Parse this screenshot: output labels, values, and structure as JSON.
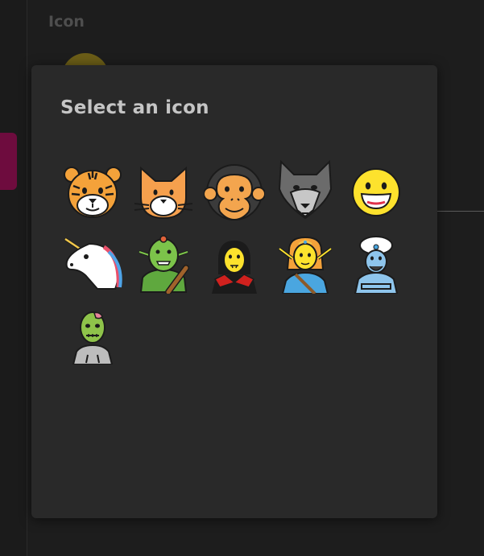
{
  "background": {
    "field_label": "Icon"
  },
  "modal": {
    "title": "Select an icon"
  },
  "icons": [
    {
      "name": "tiger-face"
    },
    {
      "name": "cat-face"
    },
    {
      "name": "monkey-face"
    },
    {
      "name": "wolf-face"
    },
    {
      "name": "grinning-face"
    },
    {
      "name": "unicorn-face"
    },
    {
      "name": "troll"
    },
    {
      "name": "vampire"
    },
    {
      "name": "elf"
    },
    {
      "name": "genie"
    },
    {
      "name": "zombie"
    }
  ],
  "colors": {
    "modal_bg": "#292929",
    "page_bg": "#1d1d1d",
    "accent_pink": "#6e0c3e",
    "title_text": "#c5c5c5"
  }
}
